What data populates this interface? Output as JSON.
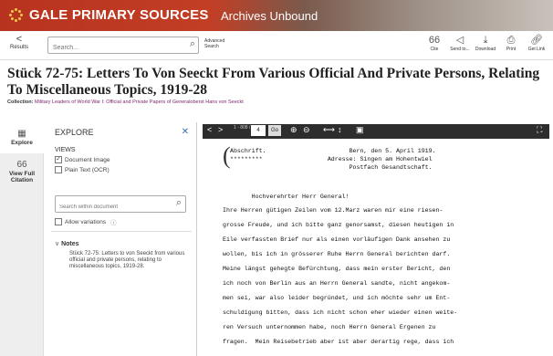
{
  "header": {
    "brand": "GALE PRIMARY SOURCES",
    "subtitle": "Archives Unbound"
  },
  "toolbar": {
    "results_label": "Results",
    "search_placeholder": "Search...",
    "advanced_label": "Advanced Search",
    "tools": [
      {
        "label": "Cite",
        "icon": "quote-icon",
        "glyph": "66"
      },
      {
        "label": "Send to...",
        "icon": "send-icon",
        "glyph": "◁"
      },
      {
        "label": "Download",
        "icon": "download-icon",
        "glyph": "⤓"
      },
      {
        "label": "Print",
        "icon": "print-icon",
        "glyph": "⎙"
      },
      {
        "label": "Get Link",
        "icon": "link-icon",
        "glyph": "🔗"
      }
    ]
  },
  "document": {
    "title": "Stück 72-75: Letters To Von Seeckt From Various Official And Private Persons, Relating To Miscellaneous Topics, 1919-28",
    "collection_label": "Collection:",
    "collection_value": "Military Leaders of World War I: Official and Private Papers of Generaloberst Hans von Seeckt"
  },
  "sidebar": {
    "explore_label": "Explore",
    "citation_label": "View Full Citation"
  },
  "explore": {
    "heading": "EXPLORE",
    "views_label": "VIEWS",
    "view_document_image": "Document Image",
    "view_plain_text": "Plain Text (OCR)",
    "search_placeholder": "Search within document",
    "allow_variations": "Allow variations",
    "notes_label": "Notes",
    "notes_text": "Stück 72-75: Letters to von Seeckt from various official and private persons, relating to miscellaneous topics, 1919-28."
  },
  "viewer": {
    "page_range": "1 - 808 /",
    "page_value": "4",
    "go_label": "Go",
    "text_lines": [
      "Abschrift.                       Bern, den 5. April 1919.",
      "*********                  Adresse: Singen am Hohentwiel",
      "                                 Postfach Gesandtschaft.",
      "",
      "        Hochverehrter Herr General!",
      "Ihre Herren gütigen Zeilen vom 12.Marz waren mir eine riesen-",
      "grosse Freude, und ich bitte ganz genorsamst, diesen heutigen in",
      "Eile verfassten Brief nur als einen vorläufigen Dank ansehen zu",
      "wollen, bis ich in grösserer Ruhe Herrn General berichten darf.",
      "Meine längst gehegte Befürchtung, dass mein erster Bericht, den",
      "ich noch von Berlin aus an Herrn General sandte, nicht angekom-",
      "men sei, war also leider begründet, und ich möchte sehr um Ent-",
      "schuldigung bitten, dass ich nicht schon eher wieder einen weite-",
      "ren Versuch unternommen habe, noch Herrn General Ergenen zu",
      "fragen.  Mein Reisebetrieb aber ist aber derartig rege, dass ich"
    ]
  }
}
